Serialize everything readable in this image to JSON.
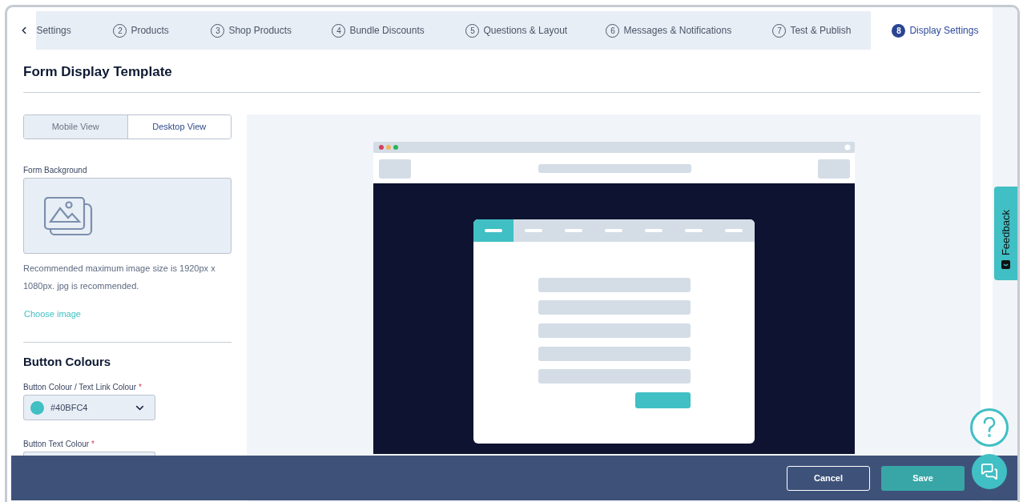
{
  "tabs": [
    {
      "label": "Settings",
      "selected": false
    },
    {
      "number": "2",
      "label": "Products",
      "selected": false
    },
    {
      "number": "3",
      "label": "Shop Products",
      "selected": false
    },
    {
      "number": "4",
      "label": "Bundle Discounts",
      "selected": false
    },
    {
      "number": "5",
      "label": "Questions & Layout",
      "selected": false
    },
    {
      "number": "6",
      "label": "Messages & Notifications",
      "selected": false
    },
    {
      "number": "7",
      "label": "Test & Publish",
      "selected": false
    },
    {
      "number": "8",
      "label": "Display Settings",
      "selected": true
    }
  ],
  "title": "Form Display Template",
  "view_toggle": [
    {
      "label": "Mobile View",
      "selected": false
    },
    {
      "label": "Desktop View",
      "selected": true
    }
  ],
  "form_background": {
    "label": "Form Background",
    "hint": "Recommended maximum image size is 1920px x 1080px. jpg is recommended.",
    "link": "Choose image"
  },
  "button_colours": {
    "heading": "Button Colours",
    "fields": [
      {
        "label": "Button Colour / Text Link Colour",
        "required_mark": "*",
        "value": "#40BFC4",
        "color": "#40bfc4"
      },
      {
        "label": "Button Text Colour",
        "required_mark": "*"
      }
    ]
  },
  "footer": {
    "buttons": [
      {
        "kind": "secondary",
        "label": "Cancel"
      },
      {
        "kind": "primary",
        "label": "Save"
      }
    ]
  },
  "feedback": {
    "label": "Feedback"
  }
}
